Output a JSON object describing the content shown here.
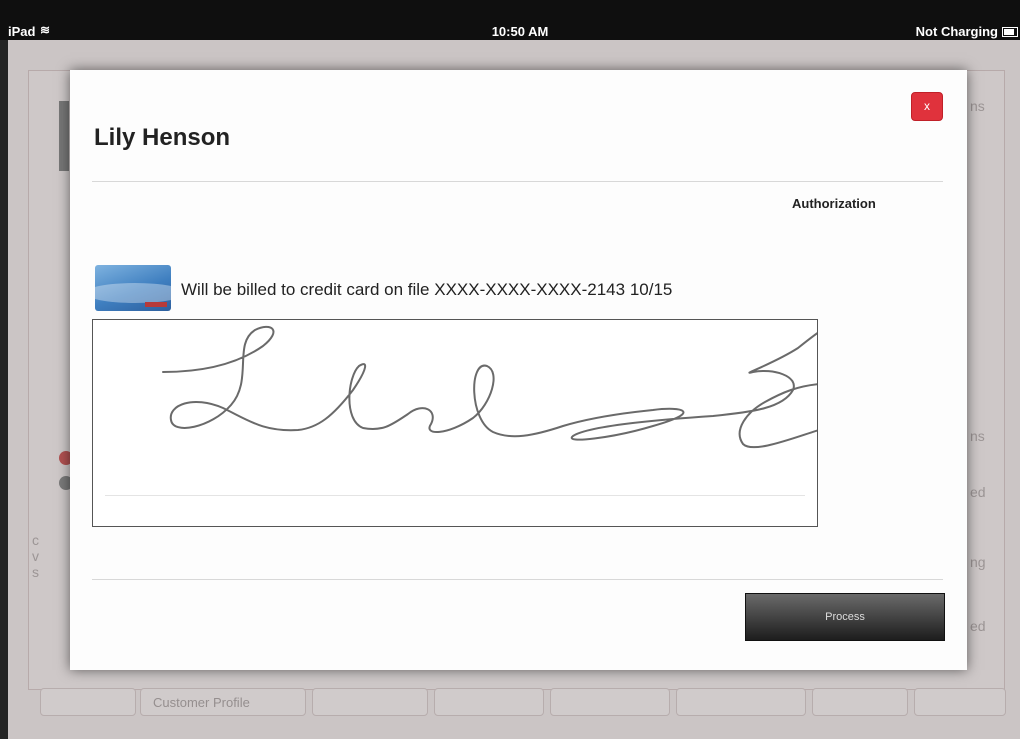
{
  "status_bar": {
    "device": "iPad",
    "time": "10:50 AM",
    "battery_status": "Not Charging",
    "icons": [
      "wifi-icon",
      "battery-icon"
    ]
  },
  "background": {
    "tab_customer_profile": "Customer Profile",
    "right_fragments": [
      "ns",
      "ns",
      "ed",
      "ng",
      "ed"
    ],
    "left_fragments": [
      "c",
      "v",
      "s"
    ]
  },
  "modal": {
    "title": "Lily Henson",
    "close_label": "x",
    "section_label": "Authorization",
    "billing_text": "Will be billed to credit card on file XXXX-XXXX-XXXX-2143 10/15",
    "card_icon": "credit-card-icon",
    "process_label": "Process"
  },
  "colors": {
    "close_button": "#e0323c",
    "process_button": "#2a2a2a",
    "status_bar": "#0f0f0f"
  }
}
